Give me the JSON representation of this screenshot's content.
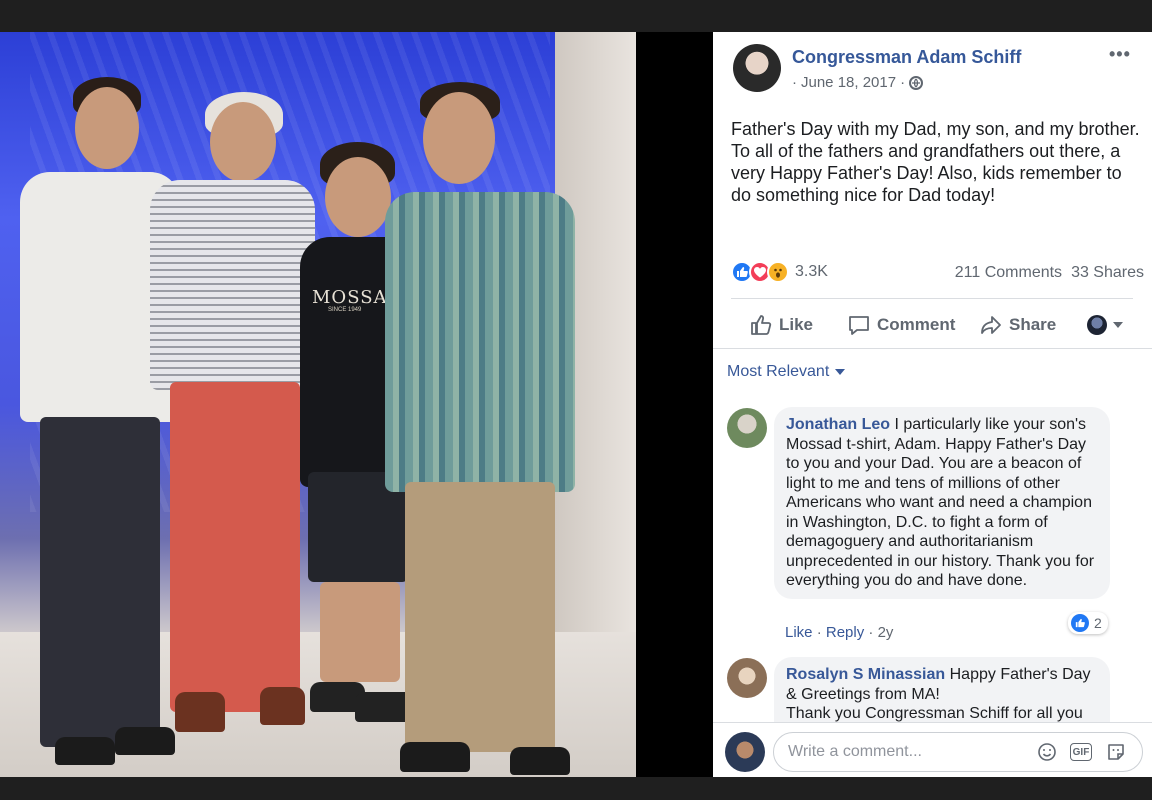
{
  "photo": {
    "shirt_text": "MOSSAD",
    "shirt_subtext": "SINCE 1949"
  },
  "post": {
    "author": "Congressman Adam Schiff",
    "date": "June 18, 2017",
    "date_prefix": "·",
    "date_suffix": "·",
    "privacy_icon": "globe-icon",
    "more_label": "•••",
    "text": "Father's Day with my Dad, my son, and my brother. To all of the fathers and grandfathers out there, a very Happy Father's Day! Also, kids remember to do something nice for Dad today!"
  },
  "stats": {
    "reaction_icons": [
      "like-icon",
      "love-icon",
      "wow-icon"
    ],
    "reaction_count": "3.3K",
    "comments": "211 Comments",
    "shares": "33 Shares"
  },
  "actions": {
    "like": "Like",
    "comment": "Comment",
    "share": "Share"
  },
  "sort": {
    "label": "Most Relevant"
  },
  "comments": [
    {
      "name": "Jonathan Leo",
      "text": "I particularly like your son's Mossad t-shirt, Adam. Happy Father's Day to you and your Dad. You are a beacon of light to me and tens of millions of other Americans who want and need a champion in Washington, D.C. to fight a form of demagoguery and authoritarianism unprecedented in our history. Thank you for everything you do and have done.",
      "like": "Like",
      "reply": "Reply",
      "age": "2y",
      "reaction_count": "2"
    },
    {
      "name": "Rosalyn S Minassian",
      "text_line1": "Happy Father's Day & Greetings from MA!",
      "text_line2": "Thank you Congressman Schiff for all you"
    }
  ],
  "composer": {
    "placeholder": "Write a comment...",
    "icons": [
      "emoji-icon",
      "gif-icon",
      "sticker-icon"
    ],
    "gif_label": "GIF"
  },
  "colors": {
    "link": "#385898",
    "author": "#365899",
    "like_blue": "#2078f4",
    "love_red": "#f33e58",
    "wow_yellow": "#f7b125"
  }
}
